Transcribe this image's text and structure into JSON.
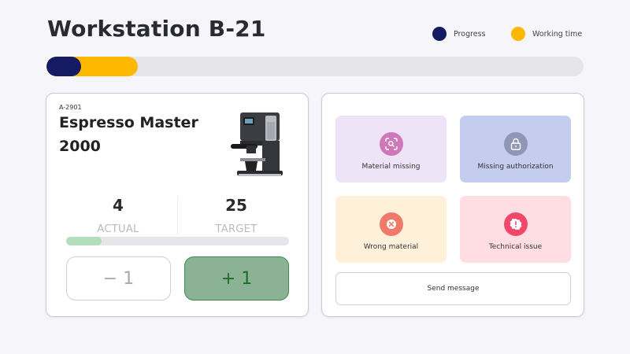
{
  "header": {
    "title": "Workstation B-21",
    "legend": [
      {
        "label": "Progress",
        "color": "#141b62"
      },
      {
        "label": "Working time",
        "color": "#ffb800"
      }
    ]
  },
  "overall_bar": {
    "progress_fraction": 0.065,
    "working_time_fraction": 0.17,
    "progress_color": "#141b62",
    "working_time_color": "#ffb800"
  },
  "product": {
    "sku": "A-2901",
    "name": "Espresso Master 2000",
    "image_icon": "espresso-machine-icon",
    "actual_value": "4",
    "actual_label": "ACTUAL",
    "target_value": "25",
    "target_label": "TARGET",
    "count_fraction": 0.16,
    "minus_label": "− 1",
    "plus_label": "+ 1"
  },
  "issues": {
    "tiles": [
      {
        "label": "Material missing",
        "icon": "scan-search-icon",
        "bg": "#efe3f8",
        "icon_color": "#cf78b8"
      },
      {
        "label": "Missing authorization",
        "icon": "lock-icon",
        "bg": "#c5cdee",
        "icon_color": "#8f97b4"
      },
      {
        "label": "Wrong material",
        "icon": "x-circle-icon",
        "bg": "#fff1d9",
        "icon_color": "#f07a6a"
      },
      {
        "label": "Technical issue",
        "icon": "alert-icon",
        "bg": "#ffdde3",
        "icon_color": "#f04868"
      }
    ],
    "send_label": "Send message"
  }
}
